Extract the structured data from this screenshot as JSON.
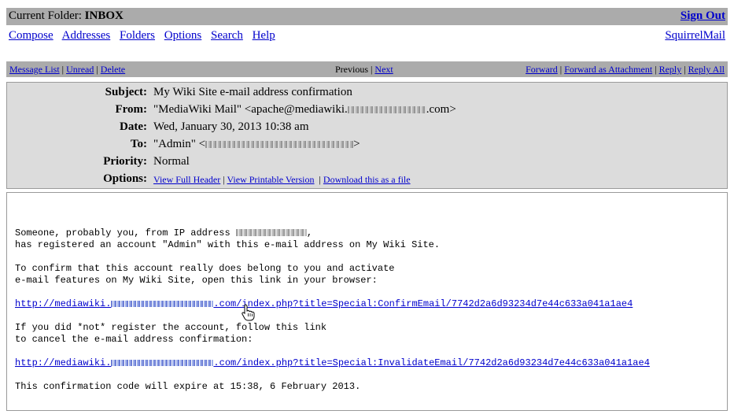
{
  "top": {
    "current_folder_label": "Current Folder:",
    "folder_name": "INBOX",
    "sign_out": "Sign Out"
  },
  "menu": {
    "items": [
      "Compose",
      "Addresses",
      "Folders",
      "Options",
      "Search",
      "Help"
    ],
    "brand": "SquirrelMail"
  },
  "nav": {
    "message_list": "Message List",
    "unread": "Unread",
    "delete": "Delete",
    "previous": "Previous",
    "next": "Next",
    "forward": "Forward",
    "forward_attach": "Forward as Attachment",
    "reply": "Reply",
    "reply_all": "Reply All"
  },
  "headers": {
    "subject_label": "Subject:",
    "subject": "My Wiki Site e-mail address confirmation",
    "from_label": "From:",
    "from_prefix": "\"MediaWiki Mail\" <apache@mediawiki.",
    "from_suffix": ".com>",
    "date_label": "Date:",
    "date": "Wed, January 30, 2013 10:38 am",
    "to_label": "To:",
    "to_prefix": "\"Admin\" <",
    "to_suffix": ">",
    "priority_label": "Priority:",
    "priority": "Normal",
    "options_label": "Options:",
    "view_full_header": "View Full Header",
    "view_printable": "View Printable Version",
    "download": "Download this as a file"
  },
  "message": {
    "line1_prefix": "Someone, probably you, from IP address ",
    "line1_suffix": ",",
    "line2": "has registered an account \"Admin\" with this e-mail address on My Wiki Site.",
    "line3": "To confirm that this account really does belong to you and activate",
    "line4": "e-mail features on My Wiki Site, open this link in your browser:",
    "link1_prefix": "http://mediawiki.",
    "link1_suffix": ".com/index.php?title=Special:ConfirmEmail/7742d2a6d93234d7e44c633a041a1ae4",
    "line5": "If you did *not* register the account, follow this link",
    "line6": "to cancel the e-mail address confirmation:",
    "link2_prefix": "http://mediawiki.",
    "link2_suffix": ".com/index.php?title=Special:InvalidateEmail/7742d2a6d93234d7e44c633a041a1ae4",
    "line7": "This confirmation code will expire at 15:38, 6 February 2013."
  }
}
